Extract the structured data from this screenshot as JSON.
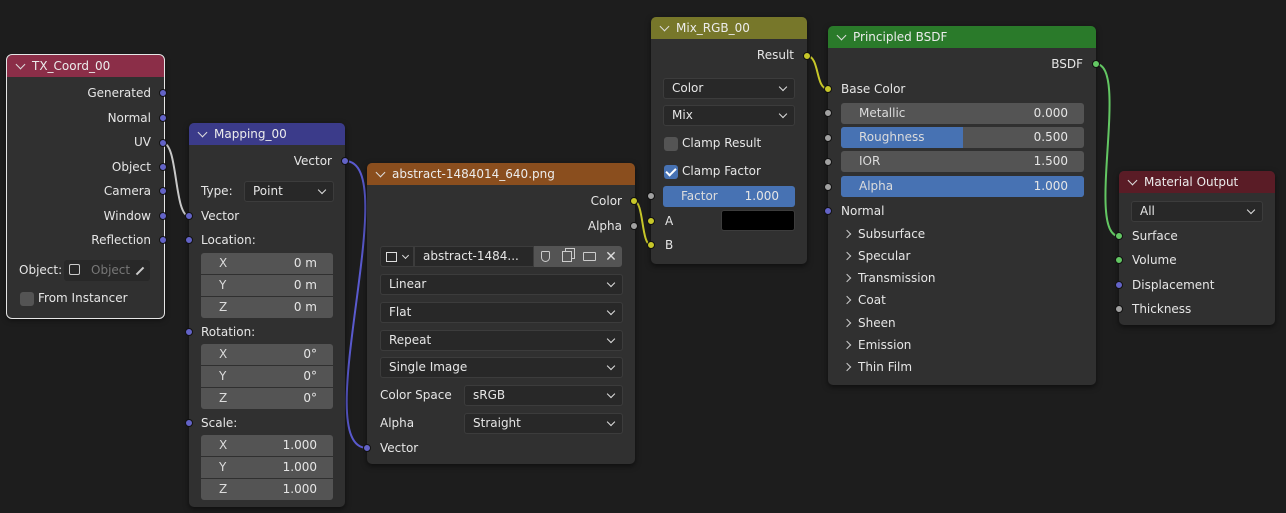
{
  "nodes": {
    "tx_coord": {
      "title": "TX_Coord_00",
      "outputs": [
        "Generated",
        "Normal",
        "UV",
        "Object",
        "Camera",
        "Window",
        "Reflection"
      ],
      "object_label": "Object:",
      "object_placeholder": "Object",
      "from_instancer": "From Instancer"
    },
    "mapping": {
      "title": "Mapping_00",
      "output": "Vector",
      "type_label": "Type:",
      "type_value": "Point",
      "vector_input": "Vector",
      "location_label": "Location:",
      "location": [
        {
          "axis": "X",
          "value": "0 m"
        },
        {
          "axis": "Y",
          "value": "0 m"
        },
        {
          "axis": "Z",
          "value": "0 m"
        }
      ],
      "rotation_label": "Rotation:",
      "rotation": [
        {
          "axis": "X",
          "value": "0°"
        },
        {
          "axis": "Y",
          "value": "0°"
        },
        {
          "axis": "Z",
          "value": "0°"
        }
      ],
      "scale_label": "Scale:",
      "scale": [
        {
          "axis": "X",
          "value": "1.000"
        },
        {
          "axis": "Y",
          "value": "1.000"
        },
        {
          "axis": "Z",
          "value": "1.000"
        }
      ]
    },
    "image": {
      "title": "abstract-1484014_640.png",
      "out_color": "Color",
      "out_alpha": "Alpha",
      "image_name": "abstract-1484...",
      "interpolation": "Linear",
      "projection": "Flat",
      "extension": "Repeat",
      "source": "Single Image",
      "color_space_label": "Color Space",
      "color_space_value": "sRGB",
      "alpha_label": "Alpha",
      "alpha_value": "Straight",
      "vector_input": "Vector"
    },
    "mix": {
      "title": "Mix_RGB_00",
      "output": "Result",
      "data_type": "Color",
      "blend_type": "Mix",
      "clamp_result": "Clamp Result",
      "clamp_factor": "Clamp Factor",
      "factor_label": "Factor",
      "factor_value": "1.000",
      "input_a": "A",
      "input_b": "B"
    },
    "bsdf": {
      "title": "Principled BSDF",
      "output": "BSDF",
      "base_color": "Base Color",
      "sliders": [
        {
          "label": "Metallic",
          "value": "0.000",
          "fraction": 0.0
        },
        {
          "label": "Roughness",
          "value": "0.500",
          "fraction": 0.5
        },
        {
          "label": "IOR",
          "value": "1.500",
          "fraction": 0.0
        },
        {
          "label": "Alpha",
          "value": "1.000",
          "fraction": 1.0
        }
      ],
      "normal": "Normal",
      "panels": [
        "Subsurface",
        "Specular",
        "Transmission",
        "Coat",
        "Sheen",
        "Emission",
        "Thin Film"
      ]
    },
    "output": {
      "title": "Material Output",
      "target": "All",
      "inputs": [
        "Surface",
        "Volume",
        "Displacement",
        "Thickness"
      ]
    }
  },
  "colors": {
    "tx_coord_header": "#8b2e48",
    "mapping_header": "#3b3b8a",
    "image_header": "#8a4e1e",
    "mix_header": "#77772a",
    "bsdf_header": "#2a7a2a",
    "output_header": "#5a1c26",
    "socket_vector": "#6363c7",
    "socket_color": "#c7c729",
    "socket_float": "#a1a1a1",
    "socket_shader": "#63c763",
    "slider_fill": "#4772b3"
  }
}
